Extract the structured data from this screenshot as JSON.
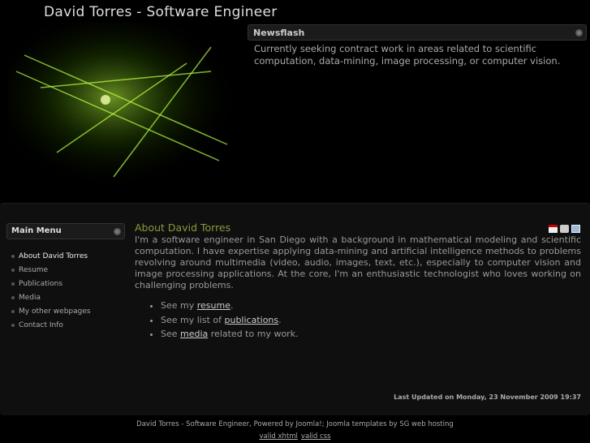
{
  "site_title": "David Torres - Software Engineer",
  "newsflash": {
    "title": "Newsflash",
    "text": "Currently seeking contract work in areas related to scientific computation, data-mining,  image processing, or computer vision."
  },
  "main_menu": {
    "title": "Main Menu",
    "items": [
      "About David Torres",
      "Resume",
      "Publications",
      "Media",
      "My other webpages",
      "Contact Info"
    ]
  },
  "article": {
    "title": "About David Torres",
    "body": "I'm a software engineer in San Diego with a background in mathematical modeling and scientific computation. I have expertise applying data-mining and artificial intelligence methods to problems revolving around multimedia (video,  audio, images, text, etc.), especially to computer vision and image processing applications.  At the core, I'm an enthusiastic technologist who loves working on challenging problems.",
    "bullets": [
      {
        "pre": "See my ",
        "link": "resume",
        "post": "."
      },
      {
        "pre": "See my list of ",
        "link": "publications",
        "post": "."
      },
      {
        "pre": "See ",
        "link": "media",
        "post": " related to my work."
      }
    ],
    "last_updated": "Last Updated on Monday, 23 November 2009 19:37",
    "icons": [
      "pdf-icon",
      "print-icon",
      "email-icon"
    ]
  },
  "footer": {
    "text": "David Torres - Software Engineer, Powered by Joomla!; Joomla templates by SG web hosting",
    "links": [
      "valid xhtml",
      "valid css"
    ]
  }
}
